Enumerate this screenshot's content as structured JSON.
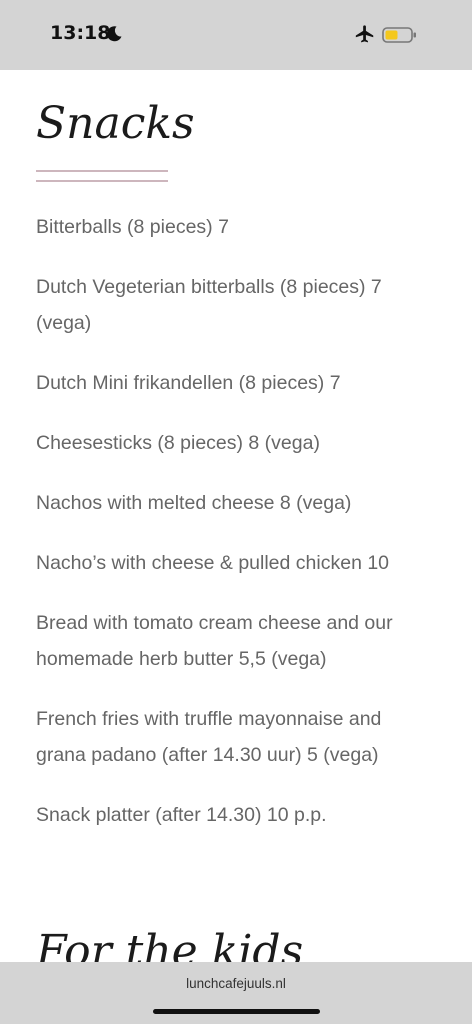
{
  "status": {
    "time": "13:18",
    "icons": [
      "moon-icon",
      "airplane-mode-icon",
      "battery-low-power-icon"
    ],
    "battery_color": "#f4c81d"
  },
  "page": {
    "snacks_title": "Snacks",
    "items": [
      "Bitterballs (8 pieces) 7",
      "Dutch Vegeterian bitterballs (8 pieces)  7 (vega)",
      "Dutch Mini frikandellen  (8 pieces) 7",
      "Cheesesticks  (8 pieces)  8 (vega)",
      "Nachos with melted cheese  8 (vega)",
      "Nacho’s with cheese & pulled chicken 10",
      "Bread with tomato cream cheese and our homemade herb butter 5,5 (vega)",
      "French fries with truffle mayonnaise and grana padano (after 14.30 uur)  5 (vega)",
      "Snack platter (after 14.30) 10 p.p."
    ],
    "kids_title": "For the kids"
  },
  "browser": {
    "url": "lunchcafejuuls.nl"
  },
  "colors": {
    "accent_divider": "#cdb6bd",
    "text": "#666666",
    "bars": "#d4d4d4"
  }
}
